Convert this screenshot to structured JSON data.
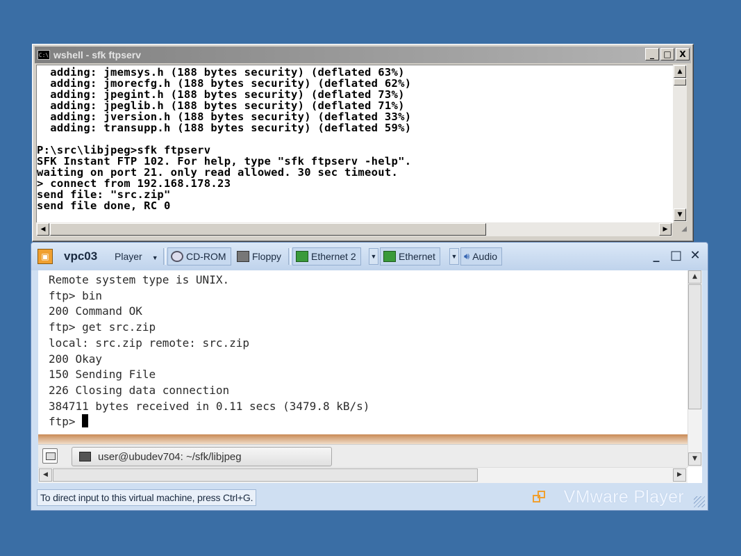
{
  "wshell": {
    "title": "wshell - sfk ftpserv",
    "icon_text": "C:\\",
    "buttons": {
      "minimize": "_",
      "maximize": "□",
      "close": "X"
    },
    "console_lines": [
      "  adding: jmemsys.h (188 bytes security) (deflated 63%)",
      "  adding: jmorecfg.h (188 bytes security) (deflated 62%)",
      "  adding: jpegint.h (188 bytes security) (deflated 73%)",
      "  adding: jpeglib.h (188 bytes security) (deflated 71%)",
      "  adding: jversion.h (188 bytes security) (deflated 33%)",
      "  adding: transupp.h (188 bytes security) (deflated 59%)",
      "",
      "P:\\src\\libjpeg>sfk ftpserv",
      "SFK Instant FTP 102. For help, type \"sfk ftpserv -help\".",
      "waiting on port 21. only read allowed. 30 sec timeout.",
      "> connect from 192.168.178.23",
      "send file: \"src.zip\"",
      "send file done, RC 0"
    ]
  },
  "vmware": {
    "vm_name": "vpc03",
    "menu_label": "Player",
    "devices": {
      "cdrom": "CD-ROM",
      "floppy": "Floppy",
      "ethernet2": "Ethernet 2",
      "ethernet": "Ethernet",
      "audio": "Audio"
    },
    "window_buttons": {
      "minimize": "_",
      "maximize": "□",
      "close": "✕"
    },
    "terminal_lines": [
      "Remote system type is UNIX.",
      "ftp> bin",
      "200 Command OK",
      "ftp> get src.zip",
      "local: src.zip remote: src.zip",
      "200 Okay",
      "150 Sending File",
      "226 Closing data connection",
      "384711 bytes received in 0.11 secs (3479.8 kB/s)"
    ],
    "prompt": "ftp> ",
    "taskbar_item": "user@ubudev704: ~/sfk/libjpeg",
    "status_text": "To direct input to this virtual machine, press Ctrl+G.",
    "brand": "VMware Player"
  },
  "colors": {
    "desktop": "#3a6ea5",
    "vmware_frame": "#cfdff2",
    "guest_accent": "#c98a56"
  }
}
